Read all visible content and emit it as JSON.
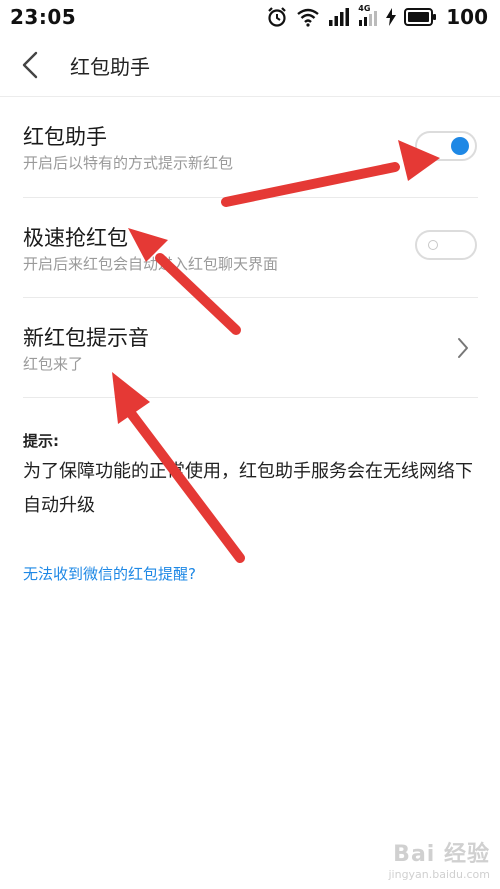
{
  "status_bar": {
    "time": "23:05",
    "network_label": "4G",
    "battery": "100"
  },
  "header": {
    "title": "红包助手"
  },
  "settings": [
    {
      "label": "红包助手",
      "description": "开启后以特有的方式提示新红包",
      "control": "toggle",
      "enabled": true
    },
    {
      "label": "极速抢红包",
      "description": "开启后来红包会自动进入红包聊天界面",
      "control": "toggle",
      "enabled": false
    },
    {
      "label": "新红包提示音",
      "description": "红包来了",
      "control": "chevron"
    }
  ],
  "tip": {
    "title": "提示:",
    "body": "为了保障功能的正常使用，红包助手服务会在无线网络下自动升级"
  },
  "help_link": "无法收到微信的红包提醒?",
  "watermark": {
    "main": "Bai 经验",
    "sub": "jingyan.baidu.com"
  },
  "colors": {
    "accent": "#1e88e5",
    "annotation_arrow": "#e53935"
  }
}
